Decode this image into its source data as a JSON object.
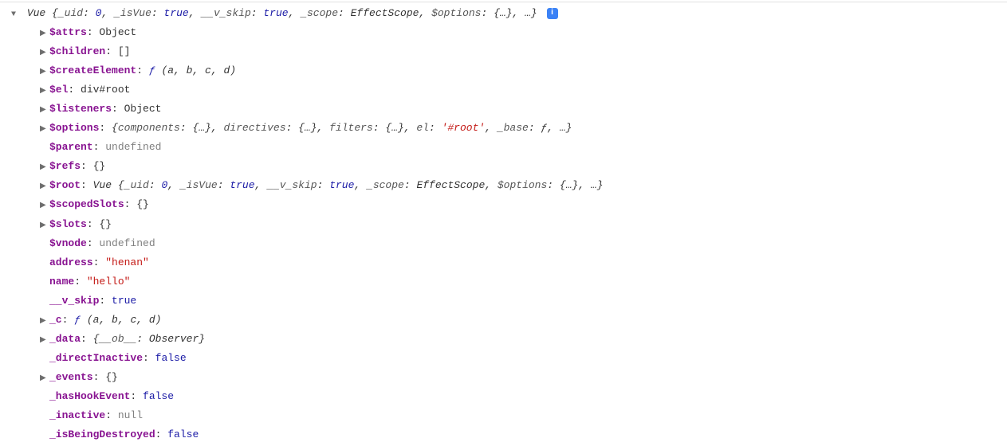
{
  "root": {
    "className": "Vue",
    "previewParts": [
      {
        "key": "_uid",
        "val": "0",
        "cls": "val-num"
      },
      {
        "key": "_isVue",
        "val": "true",
        "cls": "val-bool"
      },
      {
        "key": "__v_skip",
        "val": "true",
        "cls": "val-bool"
      },
      {
        "key": "_scope",
        "val": "EffectScope",
        "cls": "val-obj"
      },
      {
        "key": "$options",
        "val": "{…}",
        "cls": "val-obj"
      }
    ],
    "previewTail": ", …}"
  },
  "infoGlyph": "i",
  "props": [
    {
      "arrow": "right",
      "bold": true,
      "name": "$attrs",
      "type": "obj",
      "value": "Object"
    },
    {
      "arrow": "right",
      "bold": true,
      "name": "$children",
      "type": "obj",
      "value": "[]"
    },
    {
      "arrow": "right",
      "bold": true,
      "name": "$createElement",
      "type": "func",
      "value": "ƒ (a, b, c, d)"
    },
    {
      "arrow": "right",
      "bold": true,
      "name": "$el",
      "type": "obj",
      "value": "div#root"
    },
    {
      "arrow": "right",
      "bold": true,
      "name": "$listeners",
      "type": "obj",
      "value": "Object"
    },
    {
      "arrow": "right",
      "bold": true,
      "name": "$options",
      "type": "options",
      "value": ""
    },
    {
      "arrow": "none",
      "bold": true,
      "name": "$parent",
      "type": "undef",
      "value": "undefined"
    },
    {
      "arrow": "right",
      "bold": true,
      "name": "$refs",
      "type": "obj",
      "value": "{}"
    },
    {
      "arrow": "right",
      "bold": true,
      "name": "$root",
      "type": "rootref",
      "value": ""
    },
    {
      "arrow": "right",
      "bold": true,
      "name": "$scopedSlots",
      "type": "obj",
      "value": "{}"
    },
    {
      "arrow": "right",
      "bold": true,
      "name": "$slots",
      "type": "obj",
      "value": "{}"
    },
    {
      "arrow": "none",
      "bold": true,
      "name": "$vnode",
      "type": "undef",
      "value": "undefined"
    },
    {
      "arrow": "none",
      "bold": true,
      "name": "address",
      "type": "str",
      "value": "\"henan\""
    },
    {
      "arrow": "none",
      "bold": true,
      "name": "name",
      "type": "str",
      "value": "\"hello\""
    },
    {
      "arrow": "none",
      "bold": true,
      "name": "__v_skip",
      "type": "bool",
      "value": "true"
    },
    {
      "arrow": "right",
      "bold": true,
      "name": "_c",
      "type": "func",
      "value": "ƒ (a, b, c, d)"
    },
    {
      "arrow": "right",
      "bold": true,
      "name": "_data",
      "type": "data",
      "value": ""
    },
    {
      "arrow": "none",
      "bold": true,
      "name": "_directInactive",
      "type": "bool",
      "value": "false"
    },
    {
      "arrow": "right",
      "bold": true,
      "name": "_events",
      "type": "obj",
      "value": "{}"
    },
    {
      "arrow": "none",
      "bold": true,
      "name": "_hasHookEvent",
      "type": "bool",
      "value": "false"
    },
    {
      "arrow": "none",
      "bold": true,
      "name": "_inactive",
      "type": "null",
      "value": "null"
    },
    {
      "arrow": "none",
      "bold": true,
      "name": "_isBeingDestroyed",
      "type": "bool",
      "value": "false"
    }
  ],
  "optionsPreview": {
    "parts": [
      {
        "key": "components",
        "val": "{…}"
      },
      {
        "key": "directives",
        "val": "{…}"
      },
      {
        "key": "filters",
        "val": "{…}"
      },
      {
        "key": "el",
        "val": "'#root'",
        "cls": "val-str"
      },
      {
        "key": "_base",
        "val": "ƒ",
        "cls": "val-func"
      }
    ],
    "tail": ", …}"
  },
  "rootRefPreview": {
    "className": "Vue",
    "parts": [
      {
        "key": "_uid",
        "val": "0",
        "cls": "val-num"
      },
      {
        "key": "_isVue",
        "val": "true",
        "cls": "val-bool"
      },
      {
        "key": "__v_skip",
        "val": "true",
        "cls": "val-bool"
      },
      {
        "key": "_scope",
        "val": "EffectScope",
        "cls": "val-obj"
      },
      {
        "key": "$options",
        "val": "{…}",
        "cls": "val-obj"
      }
    ],
    "tail": ", …}"
  },
  "dataPreview": {
    "parts": [
      {
        "key": "__ob__",
        "val": "Observer",
        "cls": "val-obj"
      }
    ],
    "tail": "}"
  }
}
